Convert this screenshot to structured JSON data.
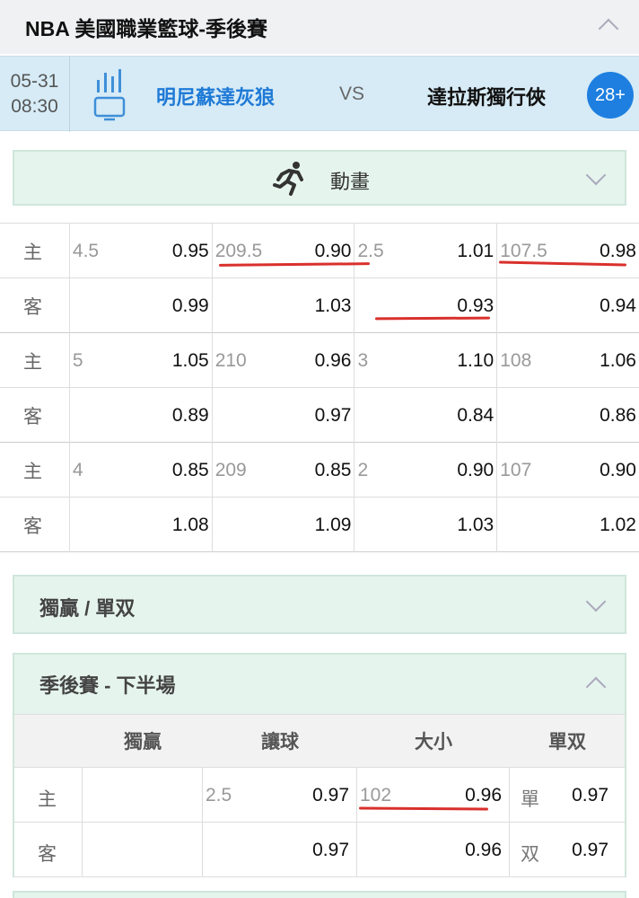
{
  "league": {
    "title": "NBA 美國職業籃球-季後賽"
  },
  "match": {
    "date": "05-31",
    "time": "08:30",
    "home": "明尼蘇達灰狼",
    "vs": "VS",
    "away": "達拉斯獨行俠",
    "more": "28+"
  },
  "animation": {
    "label": "動畫"
  },
  "odds": {
    "sides": {
      "home": "主",
      "away": "客"
    },
    "groups": [
      {
        "home": [
          {
            "line": "4.5",
            "odd": "0.95"
          },
          {
            "line": "209.5",
            "odd": "0.90"
          },
          {
            "line": "2.5",
            "odd": "1.01"
          },
          {
            "line": "107.5",
            "odd": "0.98"
          }
        ],
        "away": [
          {
            "line": "",
            "odd": "0.99"
          },
          {
            "line": "",
            "odd": "1.03"
          },
          {
            "line": "",
            "odd": "0.93"
          },
          {
            "line": "",
            "odd": "0.94"
          }
        ]
      },
      {
        "home": [
          {
            "line": "5",
            "odd": "1.05"
          },
          {
            "line": "210",
            "odd": "0.96"
          },
          {
            "line": "3",
            "odd": "1.10"
          },
          {
            "line": "108",
            "odd": "1.06"
          }
        ],
        "away": [
          {
            "line": "",
            "odd": "0.89"
          },
          {
            "line": "",
            "odd": "0.97"
          },
          {
            "line": "",
            "odd": "0.84"
          },
          {
            "line": "",
            "odd": "0.86"
          }
        ]
      },
      {
        "home": [
          {
            "line": "4",
            "odd": "0.85"
          },
          {
            "line": "209",
            "odd": "0.85"
          },
          {
            "line": "2",
            "odd": "0.90"
          },
          {
            "line": "107",
            "odd": "0.90"
          }
        ],
        "away": [
          {
            "line": "",
            "odd": "1.08"
          },
          {
            "line": "",
            "odd": "1.09"
          },
          {
            "line": "",
            "odd": "1.03"
          },
          {
            "line": "",
            "odd": "1.02"
          }
        ]
      }
    ]
  },
  "winner_oddeven": {
    "label": "獨贏 / 單双"
  },
  "second_half": {
    "title": "季後賽 - 下半場",
    "columns": [
      "獨贏",
      "讓球",
      "大小",
      "單双"
    ],
    "home": {
      "side": "主",
      "moneyline": "",
      "hcap_line": "2.5",
      "hcap_odd": "0.97",
      "total_line": "102",
      "total_odd": "0.96",
      "oe_label": "單",
      "oe_odd": "0.97"
    },
    "away": {
      "side": "客",
      "moneyline": "",
      "hcap_line": "",
      "hcap_odd": "0.97",
      "total_line": "",
      "total_odd": "0.96",
      "oe_label": "双",
      "oe_odd": "0.97"
    }
  },
  "colors": {
    "accent": "#1f7ad6",
    "badge": "#1e7fe0",
    "panel": "#e6f4ee",
    "match_bg": "#d6ebf6",
    "underline": "#d9302c"
  }
}
